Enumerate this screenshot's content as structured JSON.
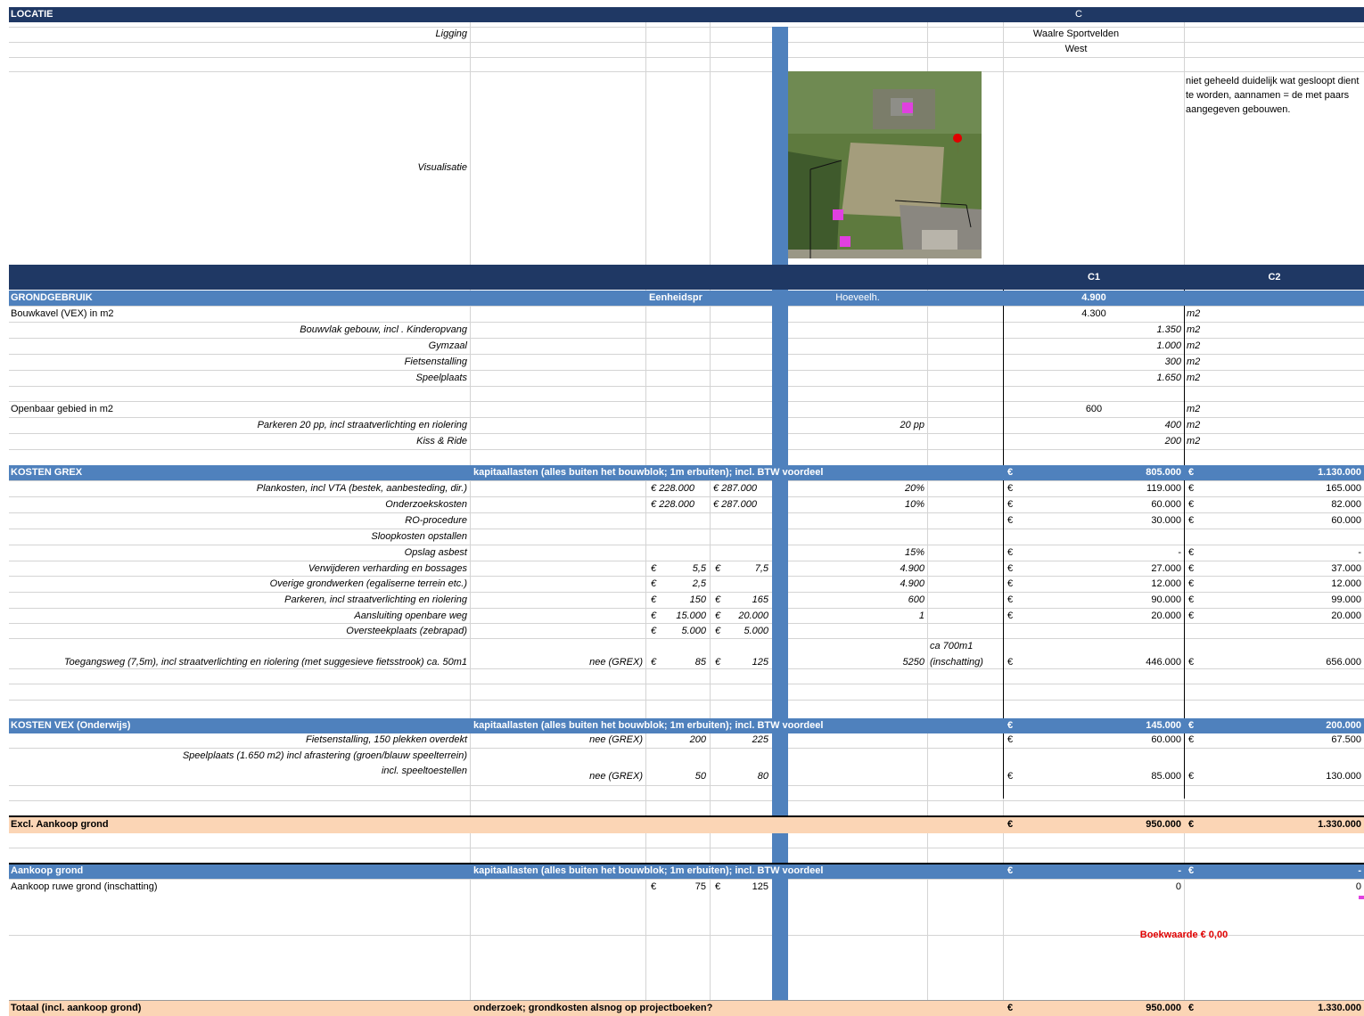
{
  "header": {
    "locatie": "LOCATIE",
    "col_c": "C"
  },
  "ligging": {
    "label": "Ligging",
    "value": "Waalre Sportvelden"
  },
  "west": "West",
  "visualisatie": {
    "label": "Visualisatie",
    "note": "niet geheeld duidelijk wat gesloopt dient te worden, aannamen = de met paars aangegeven gebouwen."
  },
  "cols": {
    "c1": "C1",
    "c2": "C2"
  },
  "grondgebruik": {
    "title": "GRONDGEBRUIK",
    "eenheid": "Eenheidspr",
    "hoeveel": "Hoeveelh.",
    "total": "4.900",
    "bouwkavel": {
      "label": "Bouwkavel (VEX) in m2",
      "value": "4.300",
      "unit": "m2"
    },
    "items": [
      {
        "label": "Bouwvlak gebouw, incl . Kinderopvang",
        "value": "1.350",
        "unit": "m2"
      },
      {
        "label": "Gymzaal",
        "value": "1.000",
        "unit": "m2"
      },
      {
        "label": "Fietsenstalling ",
        "value": "300",
        "unit": "m2"
      },
      {
        "label": "Speelplaats",
        "value": "1.650",
        "unit": "m2"
      }
    ],
    "openbaar": {
      "label": "Openbaar gebied in m2",
      "value": "600",
      "unit": "m2"
    },
    "items2": [
      {
        "label": "Parkeren 20 pp, incl  straatverlichting en riolering",
        "hoeveel": "20 pp",
        "value": "400",
        "unit": "m2"
      },
      {
        "label": "Kiss & Ride",
        "value": "200",
        "unit": "m2"
      }
    ]
  },
  "grex": {
    "title": "KOSTEN GREX",
    "desc": "kapitaallasten (alles buiten het bouwblok; 1m erbuiten); incl. BTW voordeel",
    "eur": "€",
    "c1": "805.000",
    "c2": "1.130.000",
    "rows": [
      {
        "label": "Plankosten, incl VTA (bestek, aanbesteding, dir.)",
        "p1": "€  228.000",
        "p2": "€  287.000",
        "q": "20%",
        "e1": "€",
        "c1": "119.000",
        "e2": "€",
        "c2": "165.000"
      },
      {
        "label": "Onderzoekskosten",
        "p1": "€  228.000",
        "p2": "€  287.000",
        "q": "10%",
        "e1": "€",
        "c1": "60.000",
        "e2": "€",
        "c2": "82.000"
      },
      {
        "label": "RO-procedure",
        "e1": "€",
        "c1": "30.000",
        "e2": "€",
        "c2": "60.000"
      },
      {
        "label": "Sloopkosten opstallen"
      },
      {
        "label": "Opslag asbest",
        "q": "15%",
        "e1": "€",
        "c1": "-",
        "e2": "€",
        "c2": "-"
      },
      {
        "label": "Verwijderen verharding en bossages",
        "pe1": "€",
        "p1v": "5,5",
        "pe2": "€",
        "p2v": "7,5",
        "q": "4.900",
        "e1": "€",
        "c1": "27.000",
        "e2": "€",
        "c2": "37.000"
      },
      {
        "label": "Overige grondwerken (egaliserne terrein etc.)",
        "pe1": "€",
        "p1v": "2,5",
        "q": "4.900",
        "e1": "€",
        "c1": "12.000",
        "e2": "€",
        "c2": "12.000"
      },
      {
        "label": "Parkeren, incl  straatverlichting en riolering",
        "pe1": "€",
        "p1v": "150",
        "pe2": "€",
        "p2v": "165",
        "q": "600",
        "e1": "€",
        "c1": "90.000",
        "e2": "€",
        "c2": "99.000"
      },
      {
        "label": "Aansluiting openbare weg",
        "pe1": "€",
        "p1v": "15.000",
        "pe2": "€",
        "p2v": "20.000",
        "q": "1",
        "e1": "€",
        "c1": "20.000",
        "e2": "€",
        "c2": "20.000"
      },
      {
        "label": "Oversteekplaats (zebrapad)",
        "pe1": "€",
        "p1v": "5.000",
        "pe2": "€",
        "p2v": "5.000"
      }
    ],
    "toegang": {
      "label": "Toegangsweg (7,5m), incl straatverlichting en riolering (met suggesieve fietsstrook) ca. 50m1",
      "nee": "nee (GREX)",
      "pe1": "€",
      "p1v": "85",
      "pe2": "€",
      "p2v": "125",
      "q": "5250",
      "note1": "ca 700m1",
      "note2": "(inschatting)",
      "e1": "€",
      "c1": "446.000",
      "e2": "€",
      "c2": "656.000"
    }
  },
  "vex": {
    "title": "KOSTEN VEX (Onderwijs)",
    "desc": "kapitaallasten (alles buiten het bouwblok; 1m erbuiten); incl. BTW voordeel",
    "eur": "€",
    "c1": "145.000",
    "c2": "200.000",
    "row1": {
      "label": "Fietsenstalling, 150 plekken overdekt",
      "nee": "nee (GREX)",
      "p1": "200",
      "p2": "225",
      "e1": "€",
      "c1": "60.000",
      "e2": "€",
      "c2": "67.500"
    },
    "row2": {
      "label1": "Speelplaats (1.650 m2) incl afrastering (groen/blauw speelterrein)",
      "label2": "incl. speeltoestellen",
      "nee": "nee (GREX)",
      "p1": "50",
      "p2": "80",
      "e1": "€",
      "c1": "85.000",
      "e2": "€",
      "c2": "130.000"
    }
  },
  "excl": {
    "label": "Excl. Aankoop grond",
    "eur": "€",
    "c1": "950.000",
    "c2": "1.330.000"
  },
  "aankoop": {
    "title": "Aankoop grond",
    "desc": "kapitaallasten (alles buiten het bouwblok; 1m erbuiten); incl. BTW voordeel",
    "eur": "€",
    "c1": "-",
    "c2": "-",
    "row": {
      "label": "Aankoop ruwe grond (inschatting)",
      "pe1": "€",
      "p1v": "75",
      "pe2": "€",
      "p2v": "125",
      "c1": "0",
      "c2": "0"
    },
    "boekwaarde": "Boekwaarde € 0,00"
  },
  "totaal": {
    "label": "Totaal (incl. aankoop grond)",
    "desc": "onderzoek; grondkosten alsnog op projectboeken?",
    "eur": "€",
    "c1": "950.000",
    "c2": "1.330.000"
  },
  "colors": {
    "navy": "#1f3864",
    "blue": "#4f81bd",
    "peach": "#fbd5b5",
    "red": "#e00000",
    "marker": "#e040e0"
  }
}
